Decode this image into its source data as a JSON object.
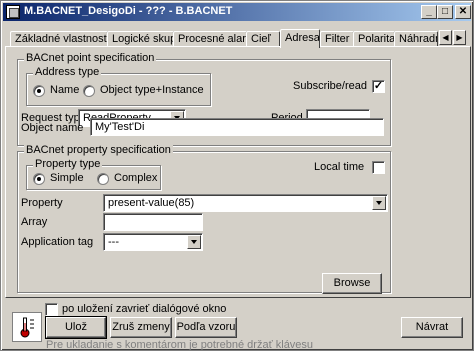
{
  "window": {
    "title": "M.BACNET_DesigoDi - ??? - B.BACNET"
  },
  "title_buttons": {
    "minimize": "_",
    "maximize": "□",
    "close": "✕"
  },
  "tabs": [
    "Základné vlastnosti",
    "Logické skupiny",
    "Procesné alarmy",
    "Cieľ",
    "Adresa",
    "Filter",
    "Polarita",
    "Náhradná"
  ],
  "active_tab": "Adresa",
  "tab_scroll": {
    "left": "◀",
    "right": "▶"
  },
  "point_spec": {
    "title": "BACnet point specification",
    "address_type": {
      "title": "Address type",
      "opt_name": "Name",
      "opt_object": "Object type+Instance",
      "selected": "Name"
    },
    "subscribe_label": "Subscribe/read",
    "subscribe_checked": "✓",
    "request_type_label": "Request type",
    "request_type_value": "ReadProperty",
    "period_label": "Period",
    "period_value": "",
    "object_name_label": "Object name",
    "object_name_value": "My'Test'Di"
  },
  "property_spec": {
    "title": "BACnet property specification",
    "property_type": {
      "title": "Property type",
      "opt_simple": "Simple",
      "opt_complex": "Complex",
      "selected": "Simple"
    },
    "local_time_label": "Local time",
    "property_label": "Property",
    "property_value": "present-value(85)",
    "array_label": "Array",
    "array_value": "",
    "app_tag_label": "Application tag",
    "app_tag_value": "---",
    "browse_label": "Browse"
  },
  "footer": {
    "close_after_save_label": "po uložení zavrieť dialógové okno",
    "save_label": "Ulož",
    "cancel_changes_label": "Zruš zmeny",
    "by_template_label": "Podľa vzoru",
    "back_label": "Návrat",
    "hint": "Pre ukladanie s komentárom je potrebné držať klávesu"
  }
}
